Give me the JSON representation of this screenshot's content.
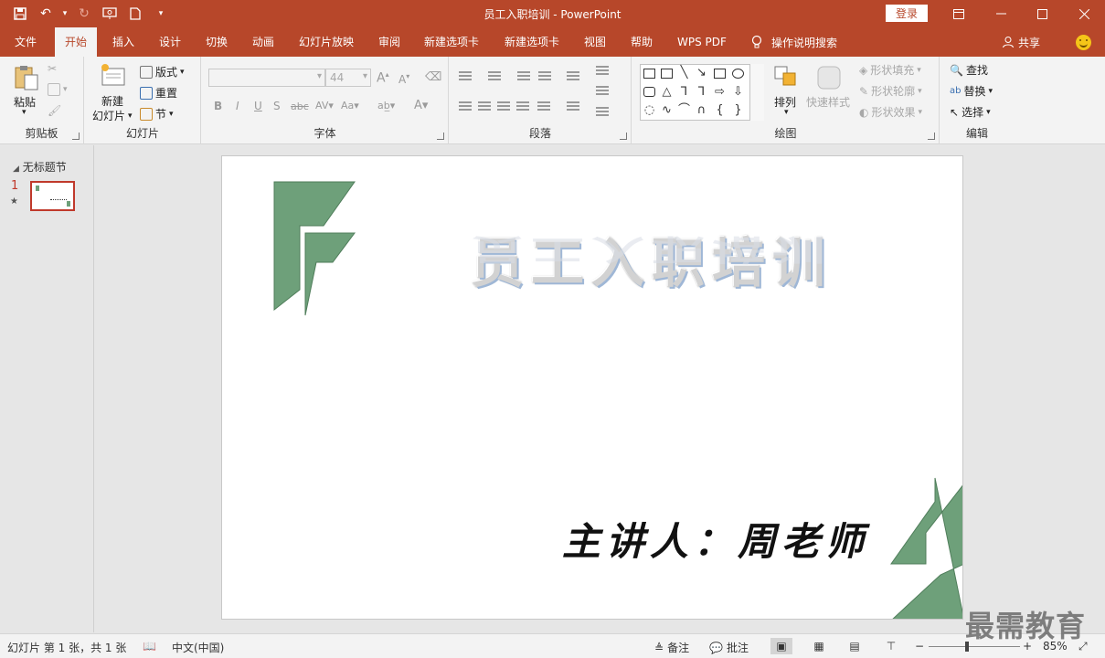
{
  "window": {
    "title": "员工入职培训  -  PowerPoint",
    "login": "登录"
  },
  "tabs": [
    "文件",
    "开始",
    "插入",
    "设计",
    "切换",
    "动画",
    "幻灯片放映",
    "审阅",
    "新建选项卡",
    "新建选项卡",
    "视图",
    "帮助",
    "WPS PDF"
  ],
  "active_tab": "开始",
  "tellme": "操作说明搜索",
  "share": "共享",
  "ribbon": {
    "clipboard": {
      "label": "剪贴板",
      "paste": "粘贴"
    },
    "slides": {
      "label": "幻灯片",
      "new_slide_1": "新建",
      "new_slide_2": "幻灯片",
      "layout": "版式",
      "reset": "重置",
      "section": "节"
    },
    "font": {
      "label": "字体",
      "size": "44"
    },
    "paragraph": {
      "label": "段落"
    },
    "drawing": {
      "label": "绘图",
      "arrange": "排列",
      "quick_styles": "快速样式",
      "fill": "形状填充",
      "outline": "形状轮廓",
      "effects": "形状效果"
    },
    "editing": {
      "label": "编辑",
      "find": "查找",
      "replace": "替换",
      "select": "选择"
    }
  },
  "panel": {
    "section_name": "无标题节",
    "slide_number": "1"
  },
  "slide": {
    "title": "员工入职培训",
    "presenter": "主讲人：周老师",
    "accent_color": "#6ea07a"
  },
  "status": {
    "slide_info": "幻灯片 第 1 张，共 1 张",
    "language": "中文(中国)",
    "notes": "备注",
    "comments": "批注",
    "zoom": "85%"
  },
  "watermark": "最需教育",
  "colors": {
    "brand": "#b7472a",
    "ribbon": "#f3f3f3"
  }
}
